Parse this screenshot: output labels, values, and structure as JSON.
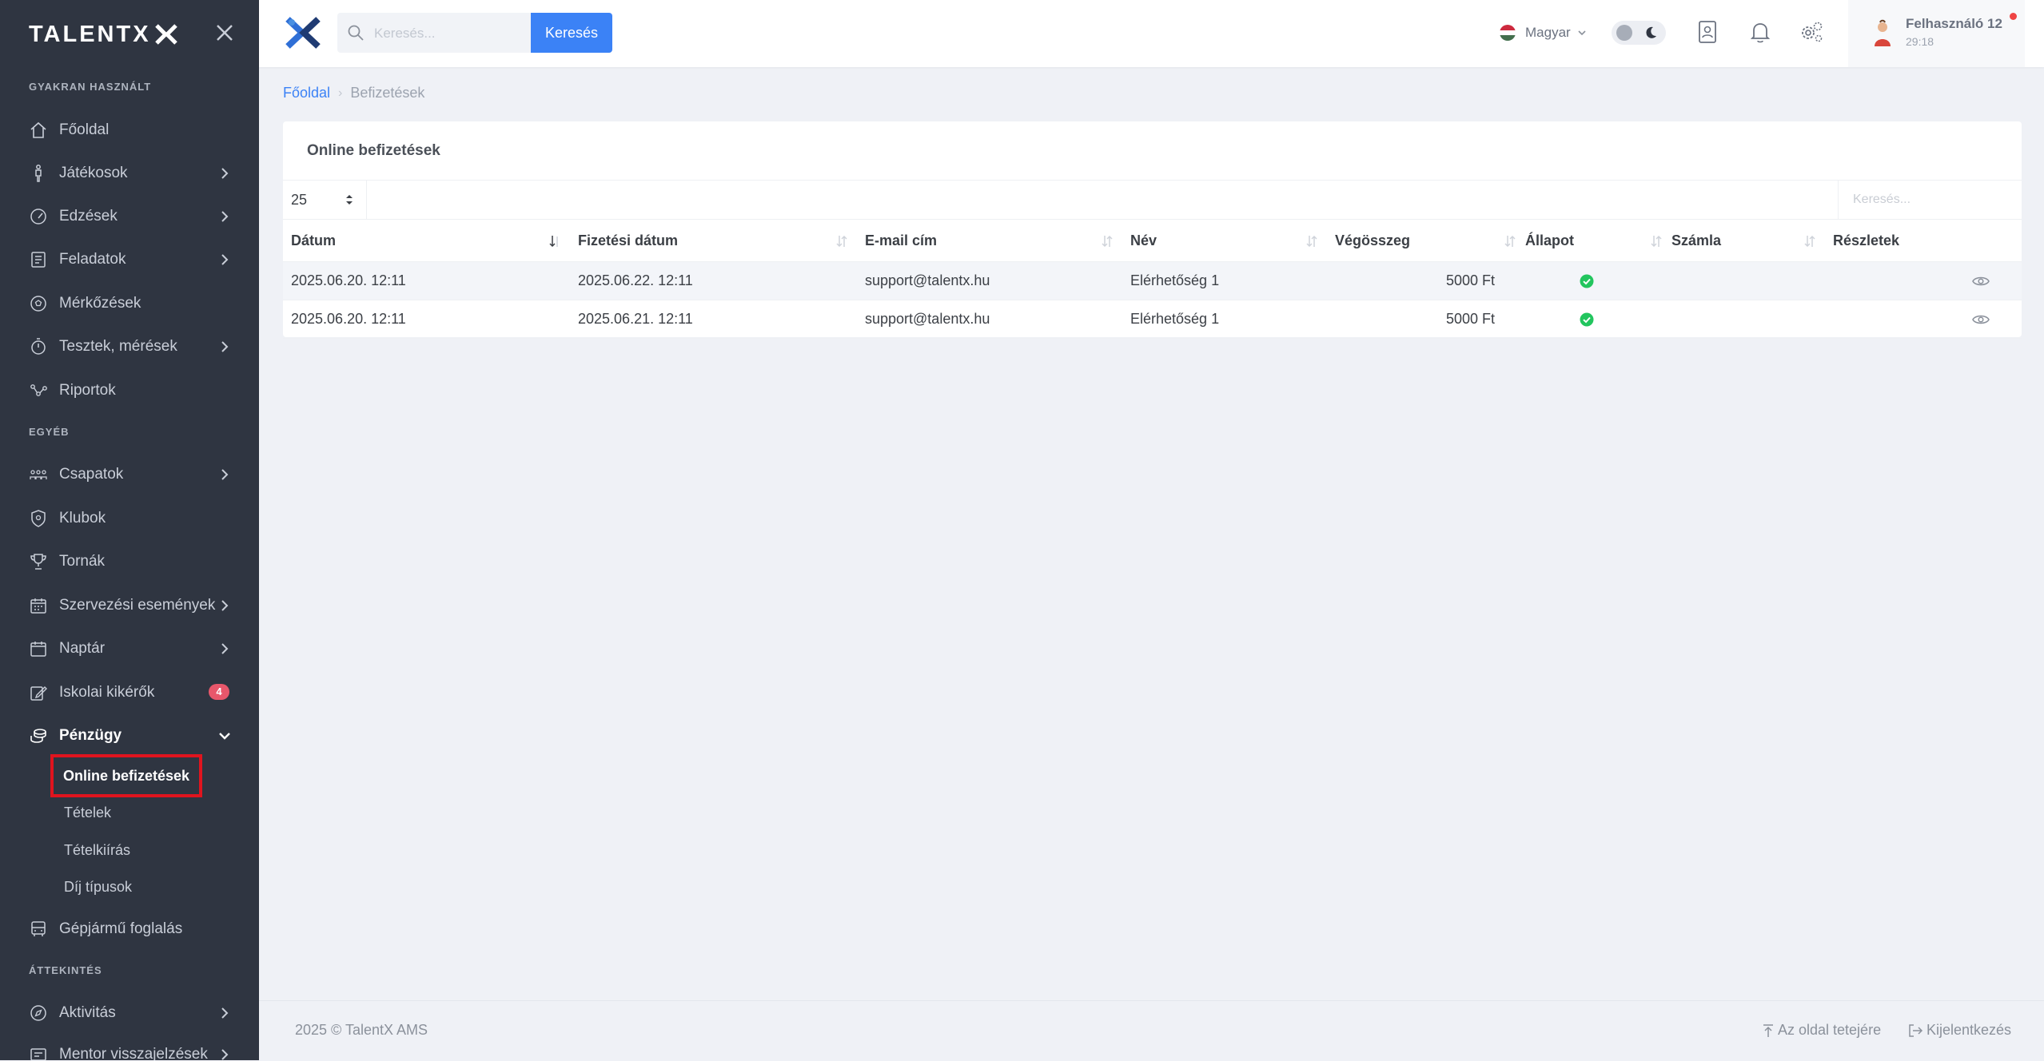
{
  "app": {
    "title": "TALENTX"
  },
  "sidebar": {
    "sections": {
      "frequent": "GYAKRAN HASZNÁLT",
      "other": "EGYÉB",
      "overview": "ÁTTEKINTÉS"
    },
    "items": [
      {
        "label": "Főoldal",
        "icon": "home-icon"
      },
      {
        "label": "Játékosok",
        "icon": "player-icon"
      },
      {
        "label": "Edzések",
        "icon": "training-gauge-icon"
      },
      {
        "label": "Feladatok",
        "icon": "tasks-icon"
      },
      {
        "label": "Mérkőzések",
        "icon": "ball-icon"
      },
      {
        "label": "Tesztek, mérések",
        "icon": "stopwatch-icon"
      },
      {
        "label": "Riportok",
        "icon": "report-graph-icon"
      },
      {
        "label": "Csapatok",
        "icon": "teams-icon"
      },
      {
        "label": "Klubok",
        "icon": "club-shield-icon"
      },
      {
        "label": "Tornák",
        "icon": "trophy-icon"
      },
      {
        "label": "Szervezési események",
        "icon": "event-calendar-icon"
      },
      {
        "label": "Naptár",
        "icon": "calendar-icon"
      },
      {
        "label": "Iskolai kikérők",
        "icon": "school-request-icon",
        "badge": "4"
      },
      {
        "label": "Pénzügy",
        "icon": "finance-coins-icon"
      },
      {
        "label": "Gépjármű foglalás",
        "icon": "bus-icon"
      },
      {
        "label": "Aktivitás",
        "icon": "compass-icon"
      },
      {
        "label": "Mentor visszajelzések",
        "icon": "feedback-icon"
      }
    ],
    "finance_sub": [
      "Online befizetések",
      "Tételek",
      "Tételkiírás",
      "Díj típusok"
    ]
  },
  "topbar": {
    "search_placeholder": "Keresés...",
    "search_button": "Keresés",
    "language": "Magyar",
    "user_name": "Felhasználó 12",
    "session_time": "29:18"
  },
  "breadcrumb": {
    "home": "Főoldal",
    "current": "Befizetések"
  },
  "card": {
    "title": "Online befizetések",
    "page_size": "25",
    "search_placeholder": "Keresés...",
    "columns": [
      "Dátum",
      "Fizetési dátum",
      "E-mail cím",
      "Név",
      "Végösszeg",
      "Állapot",
      "Számla",
      "Részletek"
    ],
    "rows": [
      {
        "date": "2025.06.20. 12:11",
        "pay_date": "2025.06.22. 12:11",
        "email": "support@talentx.hu",
        "name": "Elérhetőség 1",
        "total": "5000 Ft",
        "status": "paid",
        "invoice": ""
      },
      {
        "date": "2025.06.20. 12:11",
        "pay_date": "2025.06.21. 12:11",
        "email": "support@talentx.hu",
        "name": "Elérhetőség 1",
        "total": "5000 Ft",
        "status": "paid",
        "invoice": ""
      }
    ]
  },
  "footer": {
    "copyright": "2025 © TalentX AMS",
    "to_top": "Az oldal tetejére",
    "logout": "Kijelentkezés"
  },
  "colors": {
    "sidebar_bg": "#2f3541",
    "accent": "#3b82f6",
    "success": "#22c55e",
    "badge": "#e8576b",
    "highlight_border": "#e0141e"
  }
}
